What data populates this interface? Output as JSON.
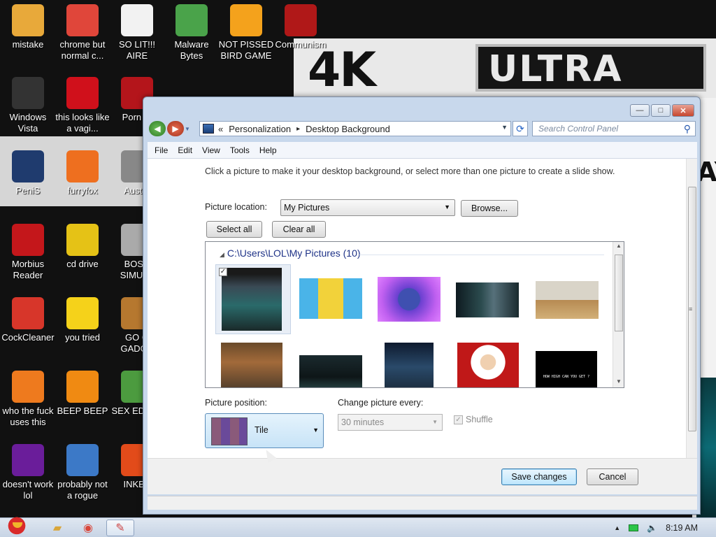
{
  "desktop": {
    "icons": [
      {
        "label": "mistake",
        "icon": "folder-settings-icon",
        "color": "#e8a93a"
      },
      {
        "label": "chrome but normal c...",
        "icon": "chrome-icon",
        "color": "#e0463a"
      },
      {
        "label": "SO LIT!!! AIRE",
        "icon": "cards-icon",
        "color": "#f2f2f2"
      },
      {
        "label": "Malware Bytes",
        "icon": "shield-icon",
        "color": "#4aa34a"
      },
      {
        "label": "NOT PISSED BIRD GAME",
        "icon": "pig-icon",
        "color": "#f4a21c"
      },
      {
        "label": "Communism",
        "icon": "emblem-icon",
        "color": "#b01818"
      },
      {
        "label": "Windows Vista",
        "icon": "trash-icon",
        "color": "#333"
      },
      {
        "label": "this looks like a vagi...",
        "icon": "opera-icon",
        "color": "#d0101b"
      },
      {
        "label": "Porn Pl",
        "icon": "flash-icon",
        "color": "#b4151b"
      },
      {
        "label": "PeniS",
        "icon": "photoshop-icon",
        "color": "#1f3b6e"
      },
      {
        "label": "furryfox",
        "icon": "firefox-icon",
        "color": "#ee6f1f"
      },
      {
        "label": "Austra",
        "icon": "spider-icon",
        "color": "#888"
      },
      {
        "label": "Morbius Reader",
        "icon": "pdf-icon",
        "color": "#c4171b"
      },
      {
        "label": "cd drive",
        "icon": "disc-icon",
        "color": "#e5c216"
      },
      {
        "label": "BOSN SIMULA",
        "icon": "gear-icon",
        "color": "#aaa"
      },
      {
        "label": "CockCleaner",
        "icon": "broom-icon",
        "color": "#d7362a"
      },
      {
        "label": "you tried",
        "icon": "star-icon",
        "color": "#f5d21a"
      },
      {
        "label": "GO G GADGE",
        "icon": "briefcase-icon",
        "color": "#b6782f"
      },
      {
        "label": "who the fuck uses this",
        "icon": "lightning-icon",
        "color": "#ee7a1e"
      },
      {
        "label": "BEEP BEEP",
        "icon": "vlc-icon",
        "color": "#f08a12"
      },
      {
        "label": "SEX EDITIO",
        "icon": "hx-icon",
        "color": "#4c9b3f"
      },
      {
        "label": "doesn't work lol",
        "icon": "yahoo-icon",
        "color": "#6a1d9a"
      },
      {
        "label": "probably not a rogue",
        "icon": "monitor-gears-icon",
        "color": "#3c79c7"
      },
      {
        "label": "INKBA",
        "icon": "ball-icon",
        "color": "#e24b1a"
      }
    ],
    "wallpaper": {
      "k4": "4K",
      "ultra": "ULTRA",
      "right_text": "AY"
    }
  },
  "window": {
    "caption": {
      "minimize": "—",
      "maximize": "□",
      "close": "✕"
    },
    "breadcrumb": {
      "overflow": "«",
      "root": "Personalization",
      "sep": "▸",
      "current": "Desktop Background"
    },
    "search_placeholder": "Search Control Panel",
    "menu": [
      "File",
      "Edit",
      "View",
      "Tools",
      "Help"
    ],
    "intro": "Click a picture to make it your desktop background, or select more than one picture to create a slide show.",
    "picture_location": {
      "label": "Picture location:",
      "value": "My Pictures",
      "browse": "Browse..."
    },
    "select_all": "Select all",
    "clear_all": "Clear all",
    "gallery": {
      "title": "C:\\Users\\LOL\\My Pictures (10)",
      "pictures": [
        {
          "desc": "movie-poster",
          "selected": true
        },
        {
          "desc": "cartoon-meme",
          "selected": false
        },
        {
          "desc": "made-in-egypt",
          "selected": false
        },
        {
          "desc": "vampire-face",
          "selected": false
        },
        {
          "desc": "pyramid",
          "selected": false
        },
        {
          "desc": "portrait-painting",
          "selected": false
        },
        {
          "desc": "dark-scene",
          "selected": false
        },
        {
          "desc": "poster-2",
          "selected": false
        },
        {
          "desc": "santa",
          "selected": false
        },
        {
          "desc": "game-screen",
          "selected": false
        }
      ],
      "game_text": "HOW HIGH CAN YOU GET ?"
    },
    "picture_position": {
      "label": "Picture position:",
      "value": "Tile"
    },
    "change_every": {
      "label": "Change picture every:",
      "value": "30 minutes"
    },
    "shuffle": {
      "label": "Shuffle",
      "checked": true
    },
    "save": "Save changes",
    "cancel": "Cancel"
  },
  "taskbar": {
    "clock": "8:19 AM",
    "tray_arrow": "▲"
  }
}
